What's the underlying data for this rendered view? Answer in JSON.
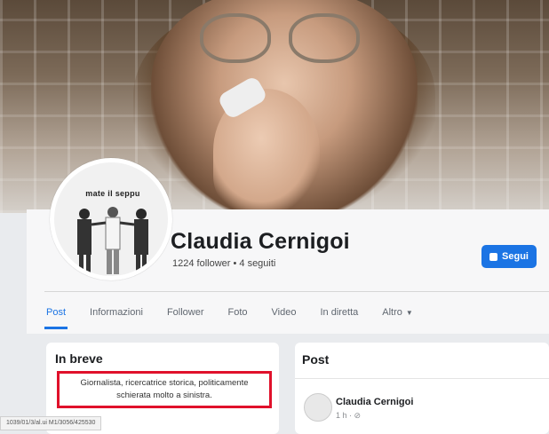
{
  "cover": {
    "image": "cover-photo"
  },
  "profile": {
    "avatar_caption": "mate il seppu",
    "name": "Claudia Cernigoi",
    "followers": "1224 follower • 4 seguiti",
    "follow_label": "Segui",
    "follow_icon": "follow-icon"
  },
  "tabs": [
    {
      "label": "Post"
    },
    {
      "label": "Informazioni"
    },
    {
      "label": "Follower"
    },
    {
      "label": "Foto"
    },
    {
      "label": "Video"
    },
    {
      "label": "In diretta"
    },
    {
      "label": "Altro"
    }
  ],
  "intro": {
    "title": "In breve",
    "bio": "Giornalista, ricercatrice storica, politicamente schierata molto a sinistra."
  },
  "posts": {
    "title": "Post",
    "author": "Claudia Cernigoi",
    "time": "1 h · ⊘"
  },
  "status_bar": {
    "url": "1039/01/3/al.ui M1/3056/425530"
  },
  "colors": {
    "accent": "#1b74e4",
    "highlight": "#e0112b"
  }
}
